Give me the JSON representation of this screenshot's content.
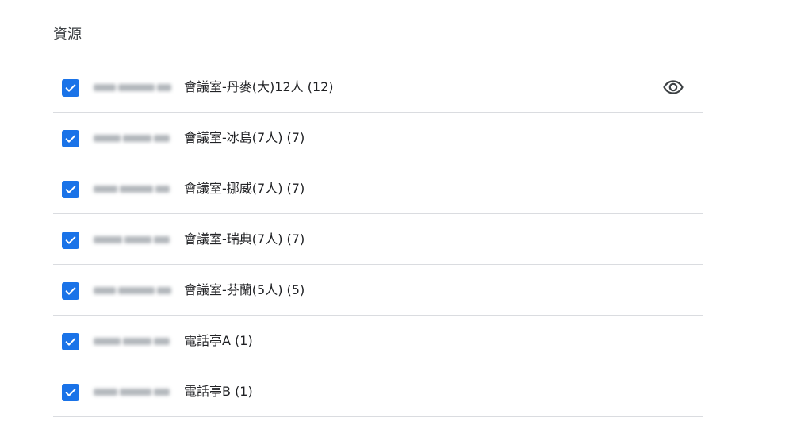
{
  "section": {
    "title": "資源"
  },
  "resources": [
    {
      "label": "會議室-丹麥(大)12人 (12)",
      "checked": true,
      "show_eye": true
    },
    {
      "label": "會議室-冰島(7人) (7)",
      "checked": true
    },
    {
      "label": "會議室-挪威(7人) (7)",
      "checked": true
    },
    {
      "label": "會議室-瑞典(7人) (7)",
      "checked": true
    },
    {
      "label": "會議室-芬蘭(5人) (5)",
      "checked": true
    },
    {
      "label": "電話亭A (1)",
      "checked": true
    },
    {
      "label": "電話亭B (1)",
      "checked": true
    }
  ],
  "icons": {
    "checkbox": "check-icon",
    "visibility": "eye-icon"
  },
  "colors": {
    "checkbox_fill": "#1a73e8",
    "divider": "#dadce0",
    "text": "#202124"
  }
}
